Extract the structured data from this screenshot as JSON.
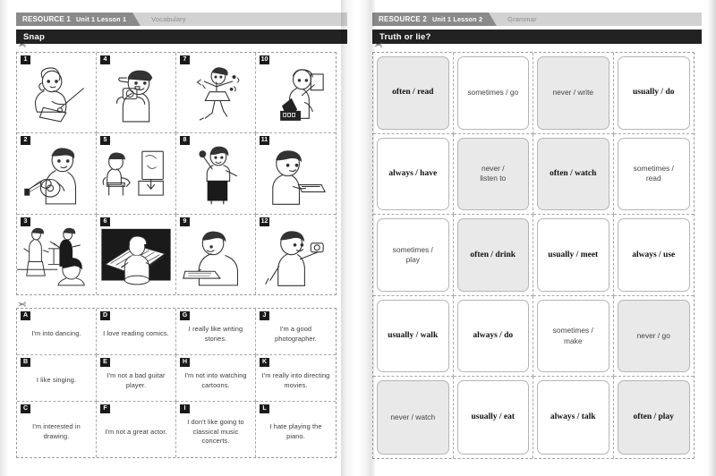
{
  "colors": {
    "tag_dark": "#8a8a8a",
    "tag_band": "#d2d2d2",
    "title_bar": "#222222",
    "card_shaded": "#e9e9e9",
    "dashed_line": "#a8a8a8"
  },
  "left_page": {
    "header": {
      "resource_label": "RESOURCE 1",
      "unit_lesson": "Unit 1  Lesson 1",
      "skill": "Vocabulary",
      "activity_title": "Snap"
    },
    "scissors_icon": "scissors-icon",
    "picture_cards": [
      {
        "badge": "1",
        "art": "girl-drawing"
      },
      {
        "badge": "4",
        "art": "boy-with-camera"
      },
      {
        "badge": "7",
        "art": "girl-dancing"
      },
      {
        "badge": "10",
        "art": "person-filming-camera"
      },
      {
        "badge": "2",
        "art": "boy-playing-guitar"
      },
      {
        "badge": "5",
        "art": "person-watching-tv"
      },
      {
        "badge": "8",
        "art": "girl-singing-microphone"
      },
      {
        "badge": "11",
        "art": "boy-reading-book"
      },
      {
        "badge": "3",
        "art": "opera-singer-and-conductor"
      },
      {
        "badge": "6",
        "art": "girl-playing-piano"
      },
      {
        "badge": "9",
        "art": "boy-writing-at-desk"
      },
      {
        "badge": "12",
        "art": "boy-taking-photo"
      }
    ],
    "sentence_cards": [
      {
        "badge": "A",
        "text": "I'm into dancing."
      },
      {
        "badge": "D",
        "text": "I love reading comics."
      },
      {
        "badge": "G",
        "text": "I really like writing stories."
      },
      {
        "badge": "J",
        "text": "I'm a good photographer."
      },
      {
        "badge": "B",
        "text": "I like singing."
      },
      {
        "badge": "E",
        "text": "I'm not a bad guitar player."
      },
      {
        "badge": "H",
        "text": "I'm not into watching cartoons."
      },
      {
        "badge": "K",
        "text": "I'm really into directing movies."
      },
      {
        "badge": "C",
        "text": "I'm interested in drawing."
      },
      {
        "badge": "F",
        "text": "I'm not a great actor."
      },
      {
        "badge": "I",
        "text": "I don't like going to classical music concerts."
      },
      {
        "badge": "L",
        "text": "I hate playing the piano."
      }
    ]
  },
  "right_page": {
    "header": {
      "resource_label": "RESOURCE 2",
      "unit_lesson": "Unit 1  Lesson 2",
      "skill": "Grammar",
      "activity_title": "Truth or lie?"
    },
    "scissors_icon": "scissors-icon",
    "prompt_cards": [
      {
        "text": "often / read",
        "shaded": true,
        "style": "serif"
      },
      {
        "text": "sometimes / go",
        "shaded": false,
        "style": "sans"
      },
      {
        "text": "never / write",
        "shaded": true,
        "style": "sans"
      },
      {
        "text": "usually / do",
        "shaded": false,
        "style": "serif"
      },
      {
        "text": "always / have",
        "shaded": false,
        "style": "serif"
      },
      {
        "text": "never /\nlisten to",
        "shaded": true,
        "style": "sans"
      },
      {
        "text": "often / watch",
        "shaded": true,
        "style": "serif"
      },
      {
        "text": "sometimes /\nread",
        "shaded": false,
        "style": "sans"
      },
      {
        "text": "sometimes /\nplay",
        "shaded": false,
        "style": "sans"
      },
      {
        "text": "often / drink",
        "shaded": true,
        "style": "serif"
      },
      {
        "text": "usually / meet",
        "shaded": false,
        "style": "serif"
      },
      {
        "text": "always / use",
        "shaded": false,
        "style": "serif"
      },
      {
        "text": "usually / walk",
        "shaded": false,
        "style": "serif"
      },
      {
        "text": "always / do",
        "shaded": false,
        "style": "serif"
      },
      {
        "text": "sometimes /\nmake",
        "shaded": false,
        "style": "sans"
      },
      {
        "text": "never / go",
        "shaded": true,
        "style": "sans"
      },
      {
        "text": "never / watch",
        "shaded": true,
        "style": "sans"
      },
      {
        "text": "usually / eat",
        "shaded": false,
        "style": "serif"
      },
      {
        "text": "always / talk",
        "shaded": false,
        "style": "serif"
      },
      {
        "text": "often / play",
        "shaded": true,
        "style": "serif"
      }
    ]
  }
}
